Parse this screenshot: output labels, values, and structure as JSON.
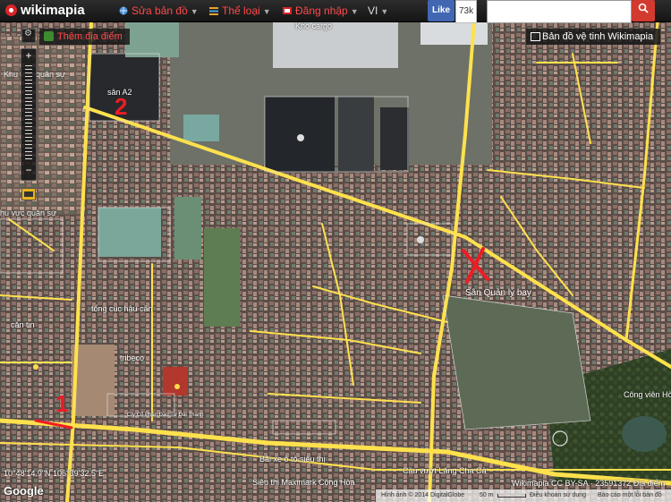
{
  "header": {
    "logo": "wikimapia",
    "menu": [
      {
        "label": "Sửa bản đồ",
        "icon": "globe-icon"
      },
      {
        "label": "Thể loại",
        "icon": "list-icon"
      },
      {
        "label": "Đăng nhập",
        "icon": "login-icon"
      },
      {
        "label": "VI",
        "icon": ""
      }
    ],
    "like_label": "Like",
    "like_count": "73k",
    "search_placeholder": ""
  },
  "controls": {
    "add_place": "Thêm địa điểm",
    "satellite": "Bản đồ vệ tinh Wikimapia",
    "zoom_in": "+",
    "zoom_out": "−"
  },
  "map_labels": {
    "kho_cargo": "Kho cargo",
    "khu_vuc_quan_su_1": "Khu vực quân sự",
    "san_a2": "sân A2",
    "khu_vuc_quan_su_2": "hu vực quân sự",
    "tong_cuc_hau_can": "tổng cục hậu cần",
    "can_tin": "căn tin",
    "tribeco": "tribeco",
    "cong_ty": "Cty Cổ Phần Đầu Tư Đất Thành",
    "san_quan_ly_bay": "Sân Quản lý bay",
    "cong_vien": "Công viên Hò",
    "bai_xe": "Bãi xe ô tô siêu thị",
    "sieu_thi": "Siêu thị Maximark Cộng Hòa",
    "cau_vuot": "Cầu vượt Lăng Cha Cả",
    "num_2": "2",
    "num_1": "1"
  },
  "overlay": {
    "coords": "10°48'14.9\"N 106°39'32.5\"E",
    "google": "Google",
    "attribution": "Wikimapia CC BY-SA · 23591372 Địa điểm"
  },
  "footer": {
    "imagery": "Hình ảnh © 2014 DigitalGlobe",
    "scale": "50 m",
    "terms": "Điều khoản sử dụng",
    "report": "Báo cáo một lỗi bản đồ"
  },
  "colors": {
    "road": "#ffe14d",
    "brand_red": "#d9242a",
    "marker_red": "#ee1c25"
  }
}
